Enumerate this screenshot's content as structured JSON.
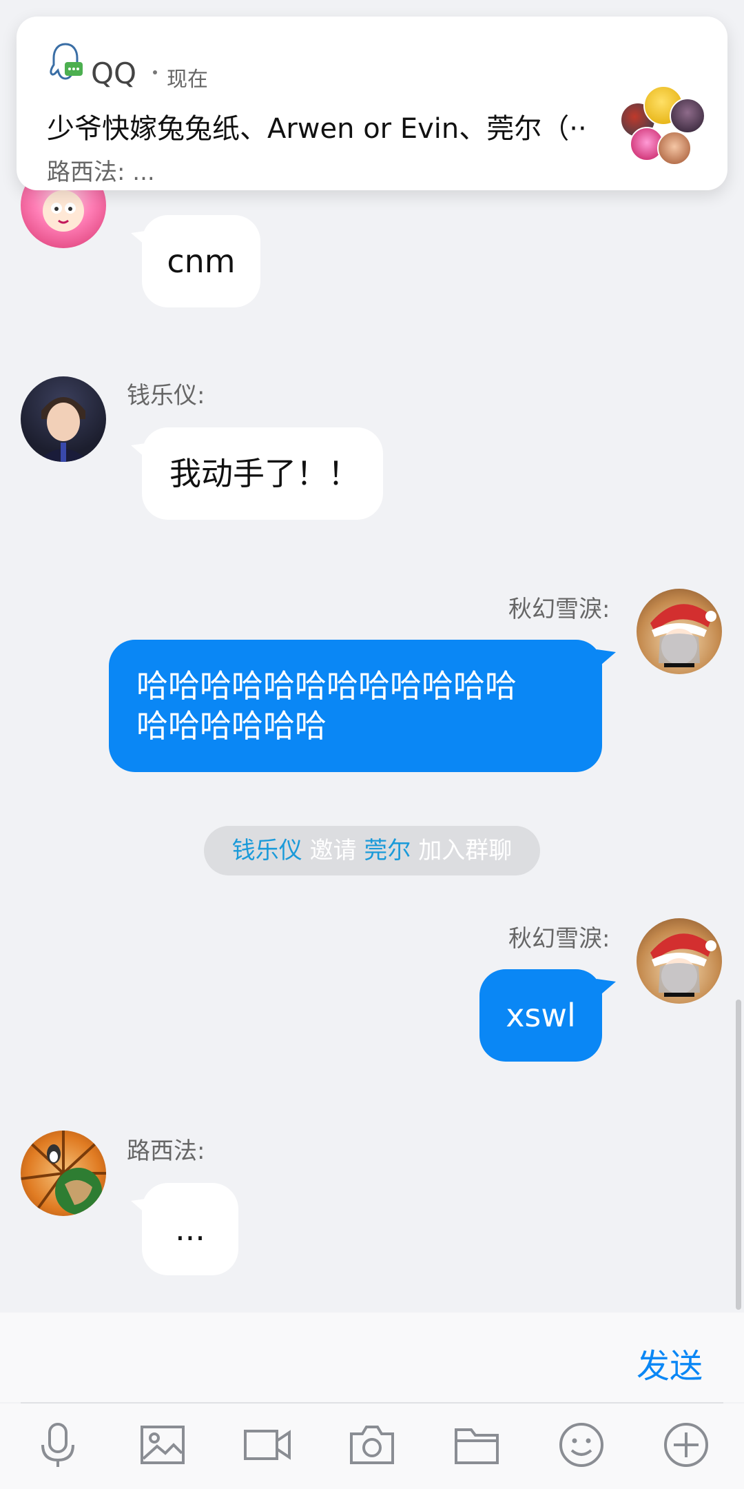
{
  "notification": {
    "app_name": "QQ",
    "time": "现在",
    "title": "少爷快嫁兔兔纸、Arwen or Evin、莞尔（··",
    "body": "路西法: ..."
  },
  "messages": [
    {
      "text": "cnm"
    },
    {
      "sender": "钱乐仪:",
      "text": "我动手了！！"
    },
    {
      "sender": "秋幻雪淚:",
      "line1": "哈哈哈哈哈哈哈哈哈哈哈哈",
      "line2": "哈哈哈哈哈哈"
    },
    {
      "sender": "秋幻雪淚:",
      "text": "xswl"
    },
    {
      "sender": "路西法:",
      "text": "..."
    }
  ],
  "system": {
    "inviter": "钱乐仪",
    "action": "邀请",
    "invitee": "莞尔",
    "suffix": "加入群聊"
  },
  "input": {
    "send_label": "发送"
  },
  "toolbar": {
    "icons": [
      "microphone-icon",
      "image-icon",
      "video-icon",
      "camera-icon",
      "folder-icon",
      "emoji-icon",
      "plus-icon"
    ]
  },
  "colors": {
    "accent": "#0a87f5",
    "background": "#f1f2f5",
    "link": "#1a9ad9"
  }
}
